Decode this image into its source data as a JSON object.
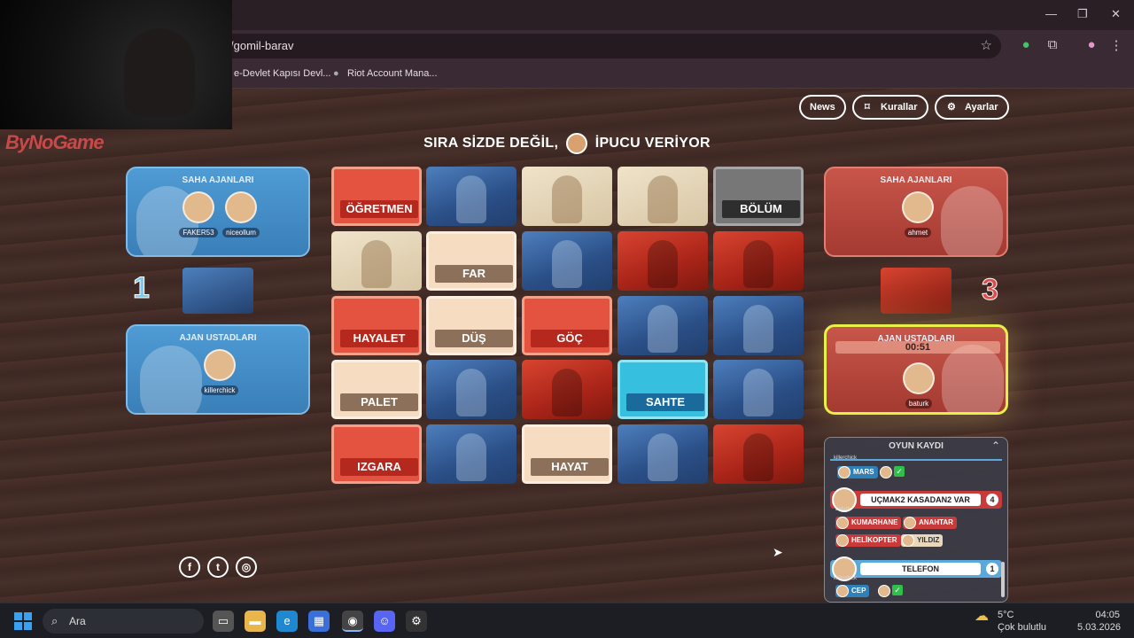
{
  "browser": {
    "url": "/gomil-barav",
    "bookmarks": [
      "e-Devlet Kapısı Devl...",
      "Riot Account Mana..."
    ],
    "window_controls": {
      "minimize": "—",
      "restore": "❐",
      "close": "✕"
    }
  },
  "watermark": "ByNoGame",
  "header": {
    "news_label": "News",
    "rules_label": "Kurallar",
    "settings_label": "Ayarlar",
    "turn_prefix": "SIRA SİZDE DEĞİL,",
    "turn_suffix": "İPUCU VERİYOR",
    "turn_player": "baturk"
  },
  "blue_team": {
    "operatives_title": "SAHA AJANLARI",
    "operatives": [
      "FAKER53",
      "niceollum"
    ],
    "score": "1",
    "spymasters_title": "AJAN USTADLARI",
    "spymasters": [
      "killerchick"
    ]
  },
  "red_team": {
    "operatives_title": "SAHA AJANLARI",
    "operatives": [
      "ahmet"
    ],
    "score": "3",
    "spymasters_title": "AJAN USTADLARI",
    "timer": "00:51",
    "spymasters": [
      "baturk"
    ]
  },
  "board": [
    {
      "word": "ÖĞRETMEN",
      "type": "red-word"
    },
    {
      "word": "",
      "type": "blue-img"
    },
    {
      "word": "",
      "type": "neutral-img"
    },
    {
      "word": "",
      "type": "neutral-img"
    },
    {
      "word": "BÖLÜM",
      "type": "black"
    },
    {
      "word": "",
      "type": "neutral-img"
    },
    {
      "word": "FAR",
      "type": "neutral"
    },
    {
      "word": "",
      "type": "blue-img"
    },
    {
      "word": "",
      "type": "red-img"
    },
    {
      "word": "",
      "type": "red-img"
    },
    {
      "word": "HAYALET",
      "type": "red-word"
    },
    {
      "word": "DÜŞ",
      "type": "neutral"
    },
    {
      "word": "GÖÇ",
      "type": "red-word"
    },
    {
      "word": "",
      "type": "blue-img"
    },
    {
      "word": "",
      "type": "blue-img"
    },
    {
      "word": "PALET",
      "type": "neutral"
    },
    {
      "word": "",
      "type": "blue-img"
    },
    {
      "word": "",
      "type": "red-img"
    },
    {
      "word": "SAHTE",
      "type": "blue-word"
    },
    {
      "word": "",
      "type": "blue-img"
    },
    {
      "word": "IZGARA",
      "type": "red-word"
    },
    {
      "word": "",
      "type": "blue-img"
    },
    {
      "word": "HAYAT",
      "type": "neutral"
    },
    {
      "word": "",
      "type": "blue-img"
    },
    {
      "word": "",
      "type": "red-img"
    }
  ],
  "log": {
    "title": "OYUN KAYDI",
    "top_name": "killerchick",
    "entry1_guess": "MARS",
    "clue1": {
      "text": "UÇMAK2 KASADAN2 VAR",
      "number": "4",
      "player": "baturk"
    },
    "clue1_guesses": [
      "KUMARHANE",
      "ANAHTAR",
      "HELİKOPTER",
      "YILDIZ"
    ],
    "clue2": {
      "text": "TELEFON",
      "number": "1",
      "player": "killerchick"
    },
    "clue2_guess": "CEP"
  },
  "taskbar": {
    "search_placeholder": "Ara",
    "weather_temp": "5°C",
    "weather_desc": "Çok bulutlu",
    "time": "04:05",
    "date": "5.03.2026"
  }
}
